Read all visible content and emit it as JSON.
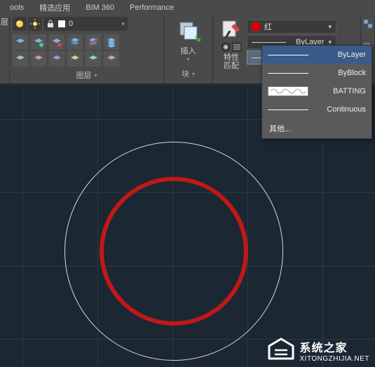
{
  "tabs": {
    "t1": "ools",
    "t2": "精选应用",
    "t3": "BIM 360",
    "t4": "Performance"
  },
  "layer": {
    "current": "0",
    "panel_label": "图层"
  },
  "block": {
    "label": "插入",
    "panel_label": "块"
  },
  "props": {
    "color_label": "红",
    "lineweight_label": "ByLayer",
    "linetype_label": "ByLayer",
    "panel_label": "特性\n匹配"
  },
  "edge": {
    "label1": "层",
    "label2": "组"
  },
  "linetype_menu": {
    "items": [
      {
        "label": "ByLayer"
      },
      {
        "label": "ByBlock"
      },
      {
        "label": "BATTING"
      },
      {
        "label": "Continuous"
      }
    ],
    "other": "其他..."
  },
  "watermark": {
    "title": "系统之家",
    "url": "XITONGZHIJIA.NET"
  }
}
